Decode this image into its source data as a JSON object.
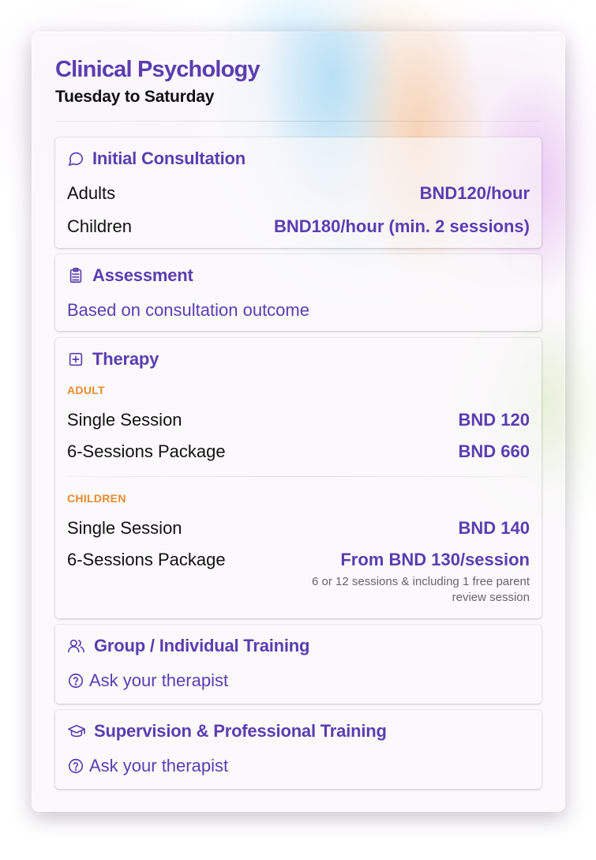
{
  "header": {
    "title": "Clinical Psychology",
    "subtitle": "Tuesday to Saturday"
  },
  "colors": {
    "accent": "#5b3db0",
    "section_label": "#e88a2c",
    "text": "#111111"
  },
  "initial_consultation": {
    "icon": "chat-bubble-icon",
    "title": "Initial Consultation",
    "rows": [
      {
        "label": "Adults",
        "value": "BND120/hour"
      },
      {
        "label": "Children",
        "value": "BND180/hour (min. 2 sessions)"
      }
    ]
  },
  "assessment": {
    "icon": "clipboard-icon",
    "title": "Assessment",
    "text": "Based on consultation outcome"
  },
  "therapy": {
    "icon": "plus-square-icon",
    "title": "Therapy",
    "adult": {
      "label": "ADULT",
      "rows": [
        {
          "label": "Single Session",
          "value": "BND 120"
        },
        {
          "label": "6-Sessions Package",
          "value": "BND 660"
        }
      ]
    },
    "children": {
      "label": "CHILDREN",
      "rows": [
        {
          "label": "Single Session",
          "value": "BND 140"
        },
        {
          "label": "6-Sessions Package",
          "value": "From BND 130/session"
        }
      ],
      "note": "6 or 12 sessions & including 1 free parent review session"
    }
  },
  "group_training": {
    "icon": "users-icon",
    "title": "Group / Individual Training",
    "ask": "Ask your therapist"
  },
  "supervision": {
    "icon": "graduation-cap-icon",
    "title": "Supervision & Professional Training",
    "ask": "Ask your therapist"
  }
}
